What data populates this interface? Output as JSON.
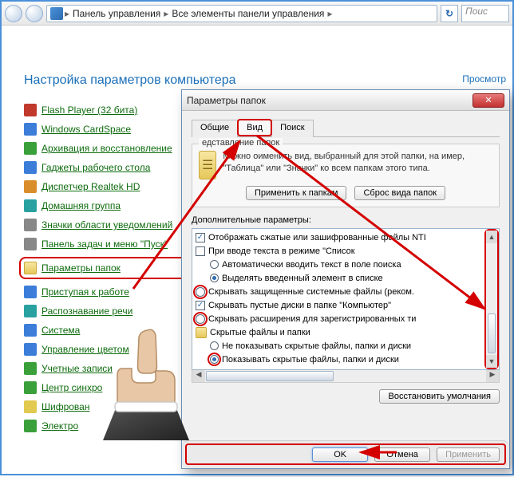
{
  "addressbar": {
    "crumb1": "Панель управления",
    "crumb2": "Все элементы панели управления",
    "search_placeholder": "Поис"
  },
  "page": {
    "title": "Настройка параметров компьютера",
    "view_link": "Просмотр"
  },
  "cpl": [
    {
      "label": "Flash Player (32 бита)",
      "icon": "red"
    },
    {
      "label": "Windows CardSpace",
      "icon": "blue"
    },
    {
      "label": "Архивация и восстановление",
      "icon": "green"
    },
    {
      "label": "Гаджеты рабочего стола",
      "icon": "blue"
    },
    {
      "label": "Диспетчер Realtek HD",
      "icon": "orange"
    },
    {
      "label": "Домашняя группа",
      "icon": "teal"
    },
    {
      "label": "Значки области уведомлений",
      "icon": "gray"
    },
    {
      "label": "Панель задач и меню \"Пуск\"",
      "icon": "gray"
    },
    {
      "label": "Параметры папок",
      "icon": "folder",
      "highlight": true
    },
    {
      "label": "Приступая к работе",
      "icon": "blue"
    },
    {
      "label": "Распознавание речи",
      "icon": "teal"
    },
    {
      "label": "Система",
      "icon": "blue"
    },
    {
      "label": "Управление цветом",
      "icon": "blue"
    },
    {
      "label": "Учетные записи",
      "icon": "green"
    },
    {
      "label": "Центр синхро",
      "icon": "green"
    },
    {
      "label": "Шифрован",
      "icon": "yellow"
    },
    {
      "label": "Электро",
      "icon": "green"
    }
  ],
  "dialog": {
    "title": "Параметры папок",
    "tabs": {
      "general": "Общие",
      "view": "Вид",
      "search": "Поиск"
    },
    "group_title": "едставление папок",
    "desc": "Можно оименить вид, выбранный для этой папки, на имер, \"Таблица\" или \"Значки\" ко всем папкам этого типа.",
    "apply_folders_btn": "Применить к папкам",
    "reset_folders_btn": "Сброс вида папок",
    "adv_label": "Дополнительные параметры:",
    "rows": [
      {
        "type": "chk",
        "checked": true,
        "text": "Отображать сжатые или зашифрованные файлы NTI"
      },
      {
        "type": "chk",
        "checked": false,
        "text": "При вводе текста в режиме \"Список"
      },
      {
        "type": "rad",
        "checked": false,
        "indent": 1,
        "text": "Автоматически вводить текст в поле поиска"
      },
      {
        "type": "rad",
        "checked": true,
        "indent": 1,
        "text": "Выделять введенный элемент в списке"
      },
      {
        "type": "chk",
        "checked": false,
        "hl": true,
        "text": "Скрывать защищенные системные файлы (реком."
      },
      {
        "type": "chk",
        "checked": true,
        "text": "Скрывать пустые диски в папке \"Компьютер\""
      },
      {
        "type": "chk",
        "checked": false,
        "hl": true,
        "text": "Скрывать расширения для зарегистрированных ти"
      },
      {
        "type": "folder",
        "text": "Скрытые файлы и папки"
      },
      {
        "type": "rad",
        "checked": false,
        "indent": 1,
        "text": "Не показывать скрытые файлы, папки и диски"
      },
      {
        "type": "rad",
        "checked": true,
        "indent": 1,
        "hl": true,
        "text": "Показывать скрытые файлы, папки и диски"
      }
    ],
    "restore_btn": "Восстановить умолчания",
    "ok_btn": "OK",
    "cancel_btn": "Отмена",
    "apply_btn": "Применить"
  }
}
